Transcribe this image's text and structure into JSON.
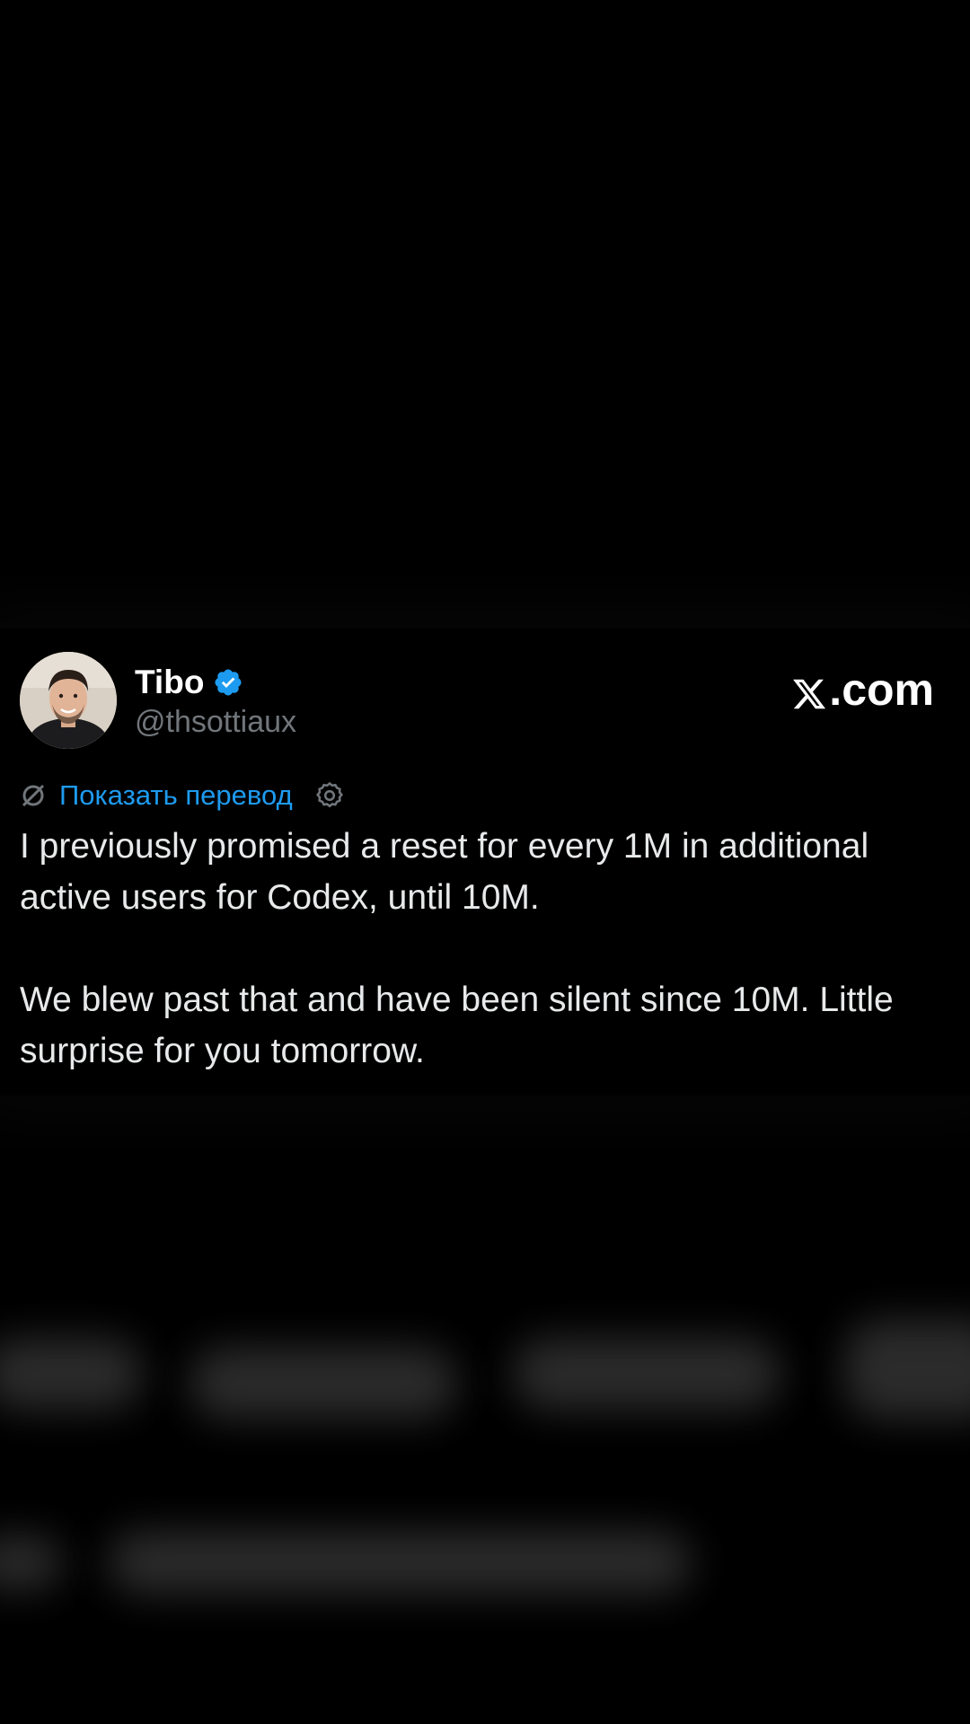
{
  "author": {
    "display_name": "Tibo",
    "handle": "@thsottiaux",
    "verified": true
  },
  "brand": {
    "site": ".com",
    "logo_icon": "x-logo-icon"
  },
  "translate": {
    "label": "Показать перевод",
    "icon": "translate-icon",
    "settings_icon": "gear-icon"
  },
  "tweet": {
    "paragraphs": [
      "I previously promised a reset for every 1M in additional active users for Codex, until 10M.",
      "We blew past that and have been silent since 10M. Little surprise for you tomorrow."
    ]
  },
  "colors": {
    "background": "#000000",
    "text": "#e7e9ea",
    "secondary": "#71767b",
    "accent": "#1d9bf0"
  }
}
